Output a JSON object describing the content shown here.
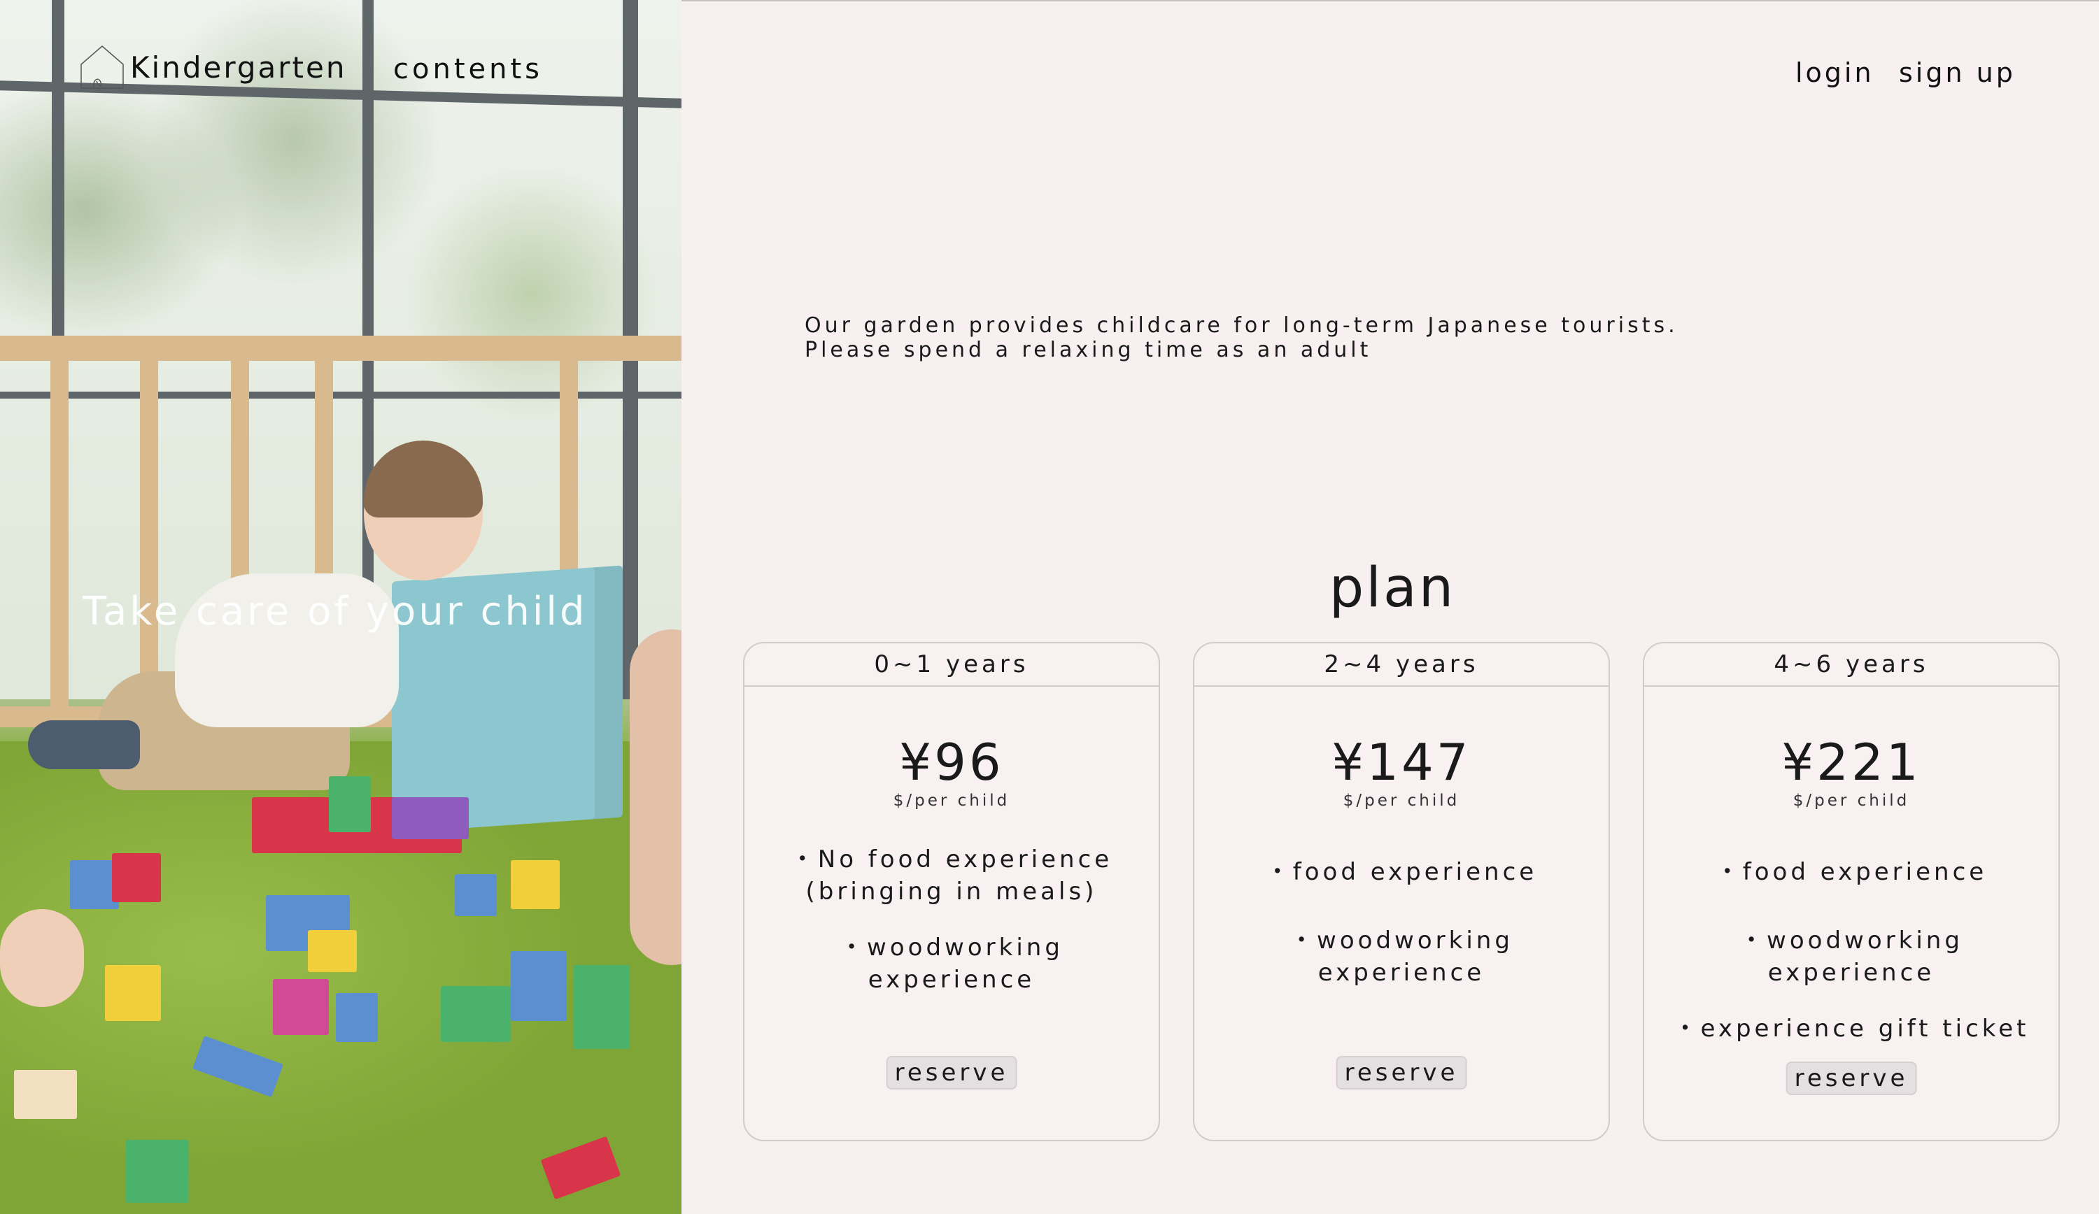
{
  "brand": {
    "name": "Kindergarten"
  },
  "nav": {
    "contents": "contents",
    "login": "login",
    "signup": "sign up"
  },
  "hero": {
    "title": "Take care of your child"
  },
  "intro": {
    "line1": "Our garden provides childcare for long-term Japanese tourists.",
    "line2": "Please spend a relaxing time as an adult"
  },
  "plan": {
    "title": "plan",
    "cards": [
      {
        "age": "0~1 years",
        "price": "¥96",
        "unit": "$/per child",
        "features": [
          "・No food experience",
          "(bringing in meals)",
          "・woodworking",
          "experience"
        ],
        "button": "reserve"
      },
      {
        "age": "2~4 years",
        "price": "¥147",
        "unit": "$/per child",
        "features": [
          "・food experience",
          "・woodworking",
          "experience"
        ],
        "button": "reserve"
      },
      {
        "age": "4~6 years",
        "price": "¥221",
        "unit": "$/per child",
        "features": [
          "・food experience",
          "・woodworking",
          "experience",
          "・experience gift ticket"
        ],
        "button": "reserve"
      }
    ]
  },
  "icons": {
    "logo": "house-icon"
  },
  "colors": {
    "background": "#f7eff0",
    "border": "#d2cbcc",
    "button": "#e4dfe0"
  }
}
